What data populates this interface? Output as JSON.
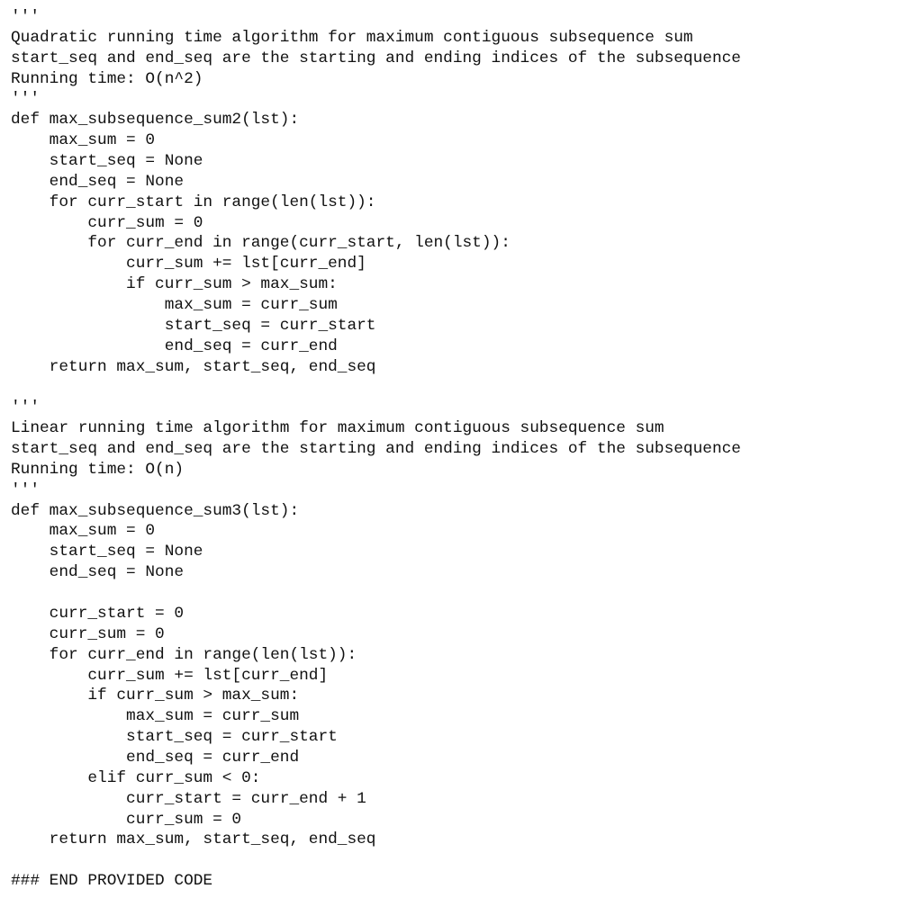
{
  "document": {
    "lines": [
      "'''",
      "Quadratic running time algorithm for maximum contiguous subsequence sum",
      "start_seq and end_seq are the starting and ending indices of the subsequence",
      "Running time: O(n^2)",
      "'''",
      "def max_subsequence_sum2(lst):",
      "    max_sum = 0",
      "    start_seq = None",
      "    end_seq = None",
      "    for curr_start in range(len(lst)):",
      "        curr_sum = 0",
      "        for curr_end in range(curr_start, len(lst)):",
      "            curr_sum += lst[curr_end]",
      "            if curr_sum > max_sum:",
      "                max_sum = curr_sum",
      "                start_seq = curr_start",
      "                end_seq = curr_end",
      "    return max_sum, start_seq, end_seq",
      "",
      "'''",
      "Linear running time algorithm for maximum contiguous subsequence sum",
      "start_seq and end_seq are the starting and ending indices of the subsequence",
      "Running time: O(n)",
      "'''",
      "def max_subsequence_sum3(lst):",
      "    max_sum = 0",
      "    start_seq = None",
      "    end_seq = None",
      "",
      "    curr_start = 0",
      "    curr_sum = 0",
      "    for curr_end in range(len(lst)):",
      "        curr_sum += lst[curr_end]",
      "        if curr_sum > max_sum:",
      "            max_sum = curr_sum",
      "            start_seq = curr_start",
      "            end_seq = curr_end",
      "        elif curr_sum < 0:",
      "            curr_start = curr_end + 1",
      "            curr_sum = 0",
      "    return max_sum, start_seq, end_seq",
      "",
      "### END PROVIDED CODE"
    ]
  }
}
